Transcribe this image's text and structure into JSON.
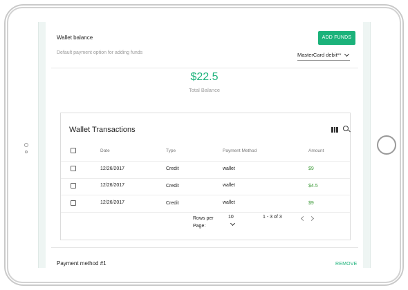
{
  "wallet": {
    "balance_label": "Wallet balance",
    "add_funds_label": "ADD FUNDS",
    "default_payment_label": "Default payment option for adding funds",
    "payment_option": "MasterCard debit**",
    "balance_amount": "$22.5",
    "balance_caption": "Total Balance"
  },
  "transactions": {
    "title": "Wallet Transactions",
    "columns": [
      "Date",
      "Type",
      "Payment Method",
      "Amount"
    ],
    "rows": [
      {
        "date": "12/26/2017",
        "type": "Credit",
        "method": "wallet",
        "amount": "$9"
      },
      {
        "date": "12/26/2017",
        "type": "Credit",
        "method": "wallet",
        "amount": "$4.5"
      },
      {
        "date": "12/26/2017",
        "type": "Credit",
        "method": "wallet",
        "amount": "$9"
      }
    ],
    "pagination": {
      "rows_per_page_label": "Rows per Page:",
      "rows_per_page_value": "10",
      "range": "1 - 3 of 3"
    }
  },
  "payment_method": {
    "title": "Payment method #1",
    "remove_label": "REMOVE"
  },
  "colors": {
    "accent": "#1bb27a",
    "amount": "#3e9b3a"
  }
}
